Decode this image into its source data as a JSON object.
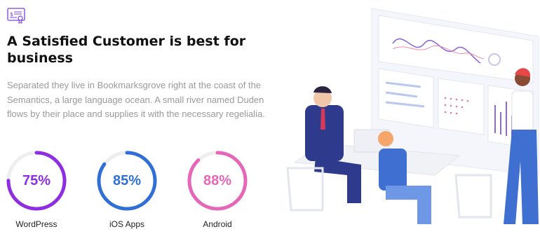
{
  "header": {
    "title": "A Satisfied Customer is best for business",
    "description": "Separated they live in Bookmarksgrove right at the coast of the Semantics, a large language ocean. A small river named Duden flows by their place and supplies it with the necessary regelialia."
  },
  "stats": [
    {
      "label": "WordPress",
      "value_text": "75%",
      "value": 75,
      "color": "#8e2de2",
      "text_color": "#8e2de2"
    },
    {
      "label": "iOS Apps",
      "value_text": "85%",
      "value": 85,
      "color": "#2f6fd6",
      "text_color": "#2f6fd6"
    },
    {
      "label": "Android",
      "value_text": "88%",
      "value": 88,
      "color": "#e667b8",
      "text_color": "#e667b8"
    }
  ],
  "icons": {
    "badge": "certificate-icon"
  },
  "colors": {
    "accent": "#7b3fe4",
    "ring_track": "#eeeeee"
  }
}
